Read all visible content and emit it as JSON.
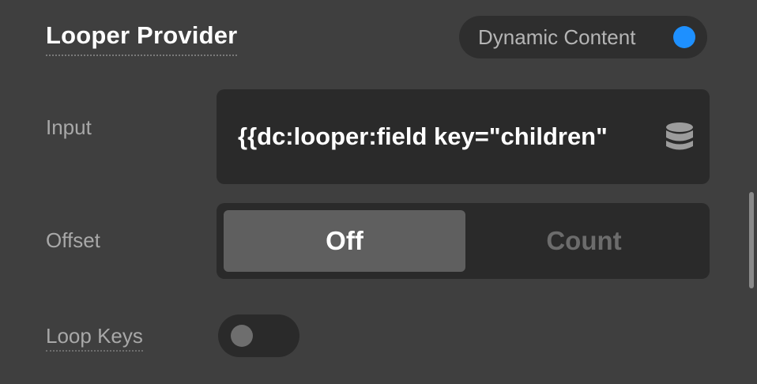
{
  "section": {
    "title": "Looper Provider"
  },
  "dynamic_content": {
    "label": "Dynamic Content",
    "accent_color": "#1e90ff"
  },
  "input": {
    "label": "Input",
    "value": "{{dc:looper:field key=\"children\"",
    "icon": "database-icon"
  },
  "offset": {
    "label": "Offset",
    "options": [
      "Off",
      "Count"
    ],
    "selected": "Off"
  },
  "loop_keys": {
    "label": "Loop Keys",
    "enabled": false
  }
}
